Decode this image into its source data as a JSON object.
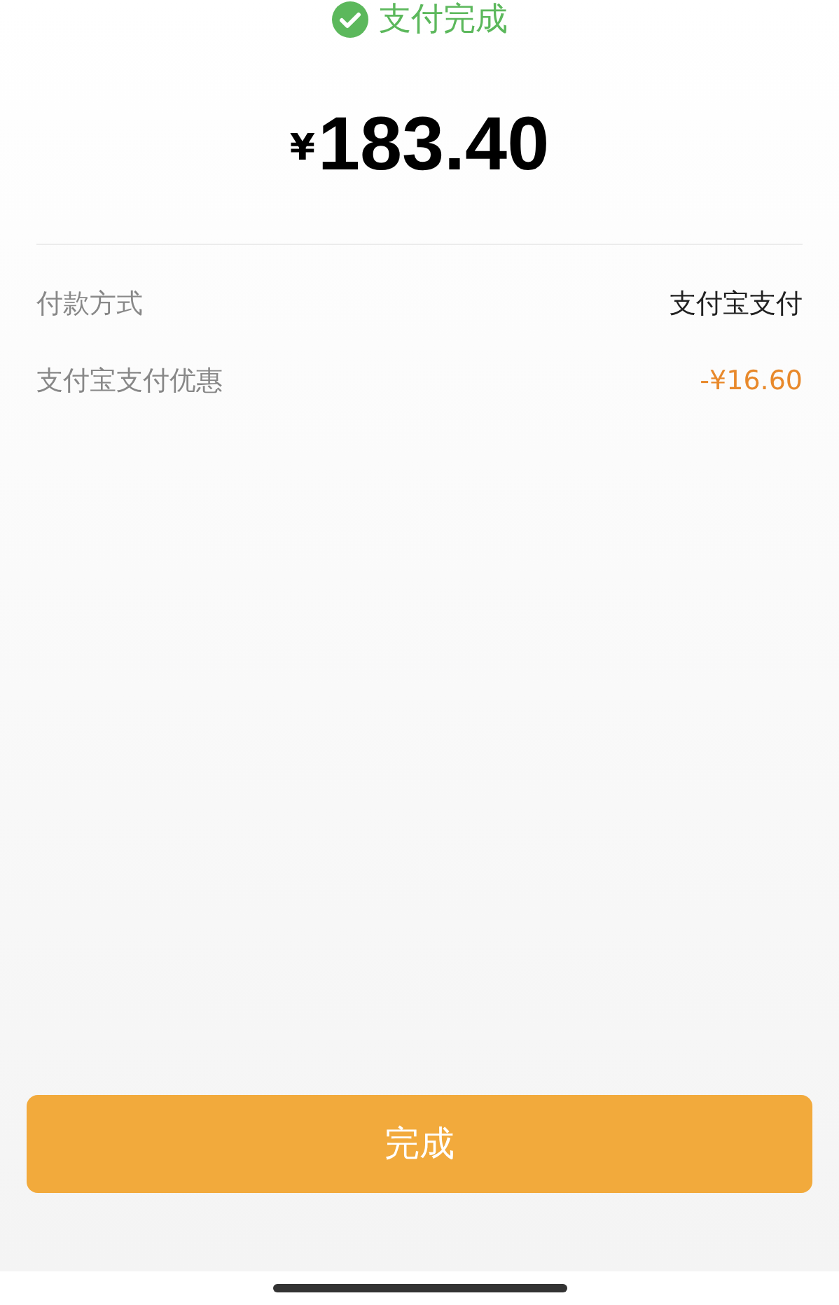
{
  "status": {
    "text": "支付完成"
  },
  "amount": {
    "currency": "¥",
    "value": "183.40"
  },
  "details": [
    {
      "label": "付款方式",
      "value": "支付宝支付",
      "kind": "normal"
    },
    {
      "label": "支付宝支付优惠",
      "value": "-¥16.60",
      "kind": "discount"
    }
  ],
  "button": {
    "label": "完成"
  }
}
